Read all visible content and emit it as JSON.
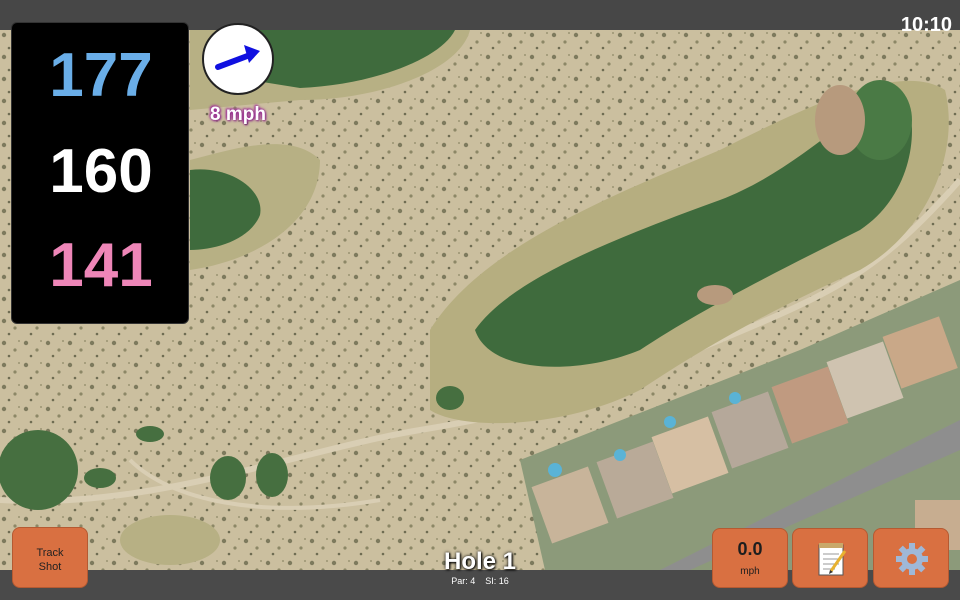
{
  "status_bar": {
    "time": "10:10"
  },
  "distances": {
    "back": "177",
    "middle": "160",
    "front": "141"
  },
  "wind": {
    "speed_label": "8 mph",
    "arrow_icon": "wind-direction-arrow-icon"
  },
  "hole": {
    "title": "Hole 1",
    "par": "Par: 4",
    "stroke_index": "SI: 16"
  },
  "buttons": {
    "track_shot": {
      "line1": "Track",
      "line2": "Shot"
    },
    "speed": {
      "value": "0.0",
      "unit": "mph"
    },
    "notes": {
      "icon": "notepad-icon"
    },
    "settings": {
      "icon": "gear-icon"
    }
  },
  "colors": {
    "back_distance": "#6aaee8",
    "middle_distance": "#ffffff",
    "front_distance": "#ee86b8",
    "button": "#d97041",
    "fairway": "#3f6b3d"
  }
}
